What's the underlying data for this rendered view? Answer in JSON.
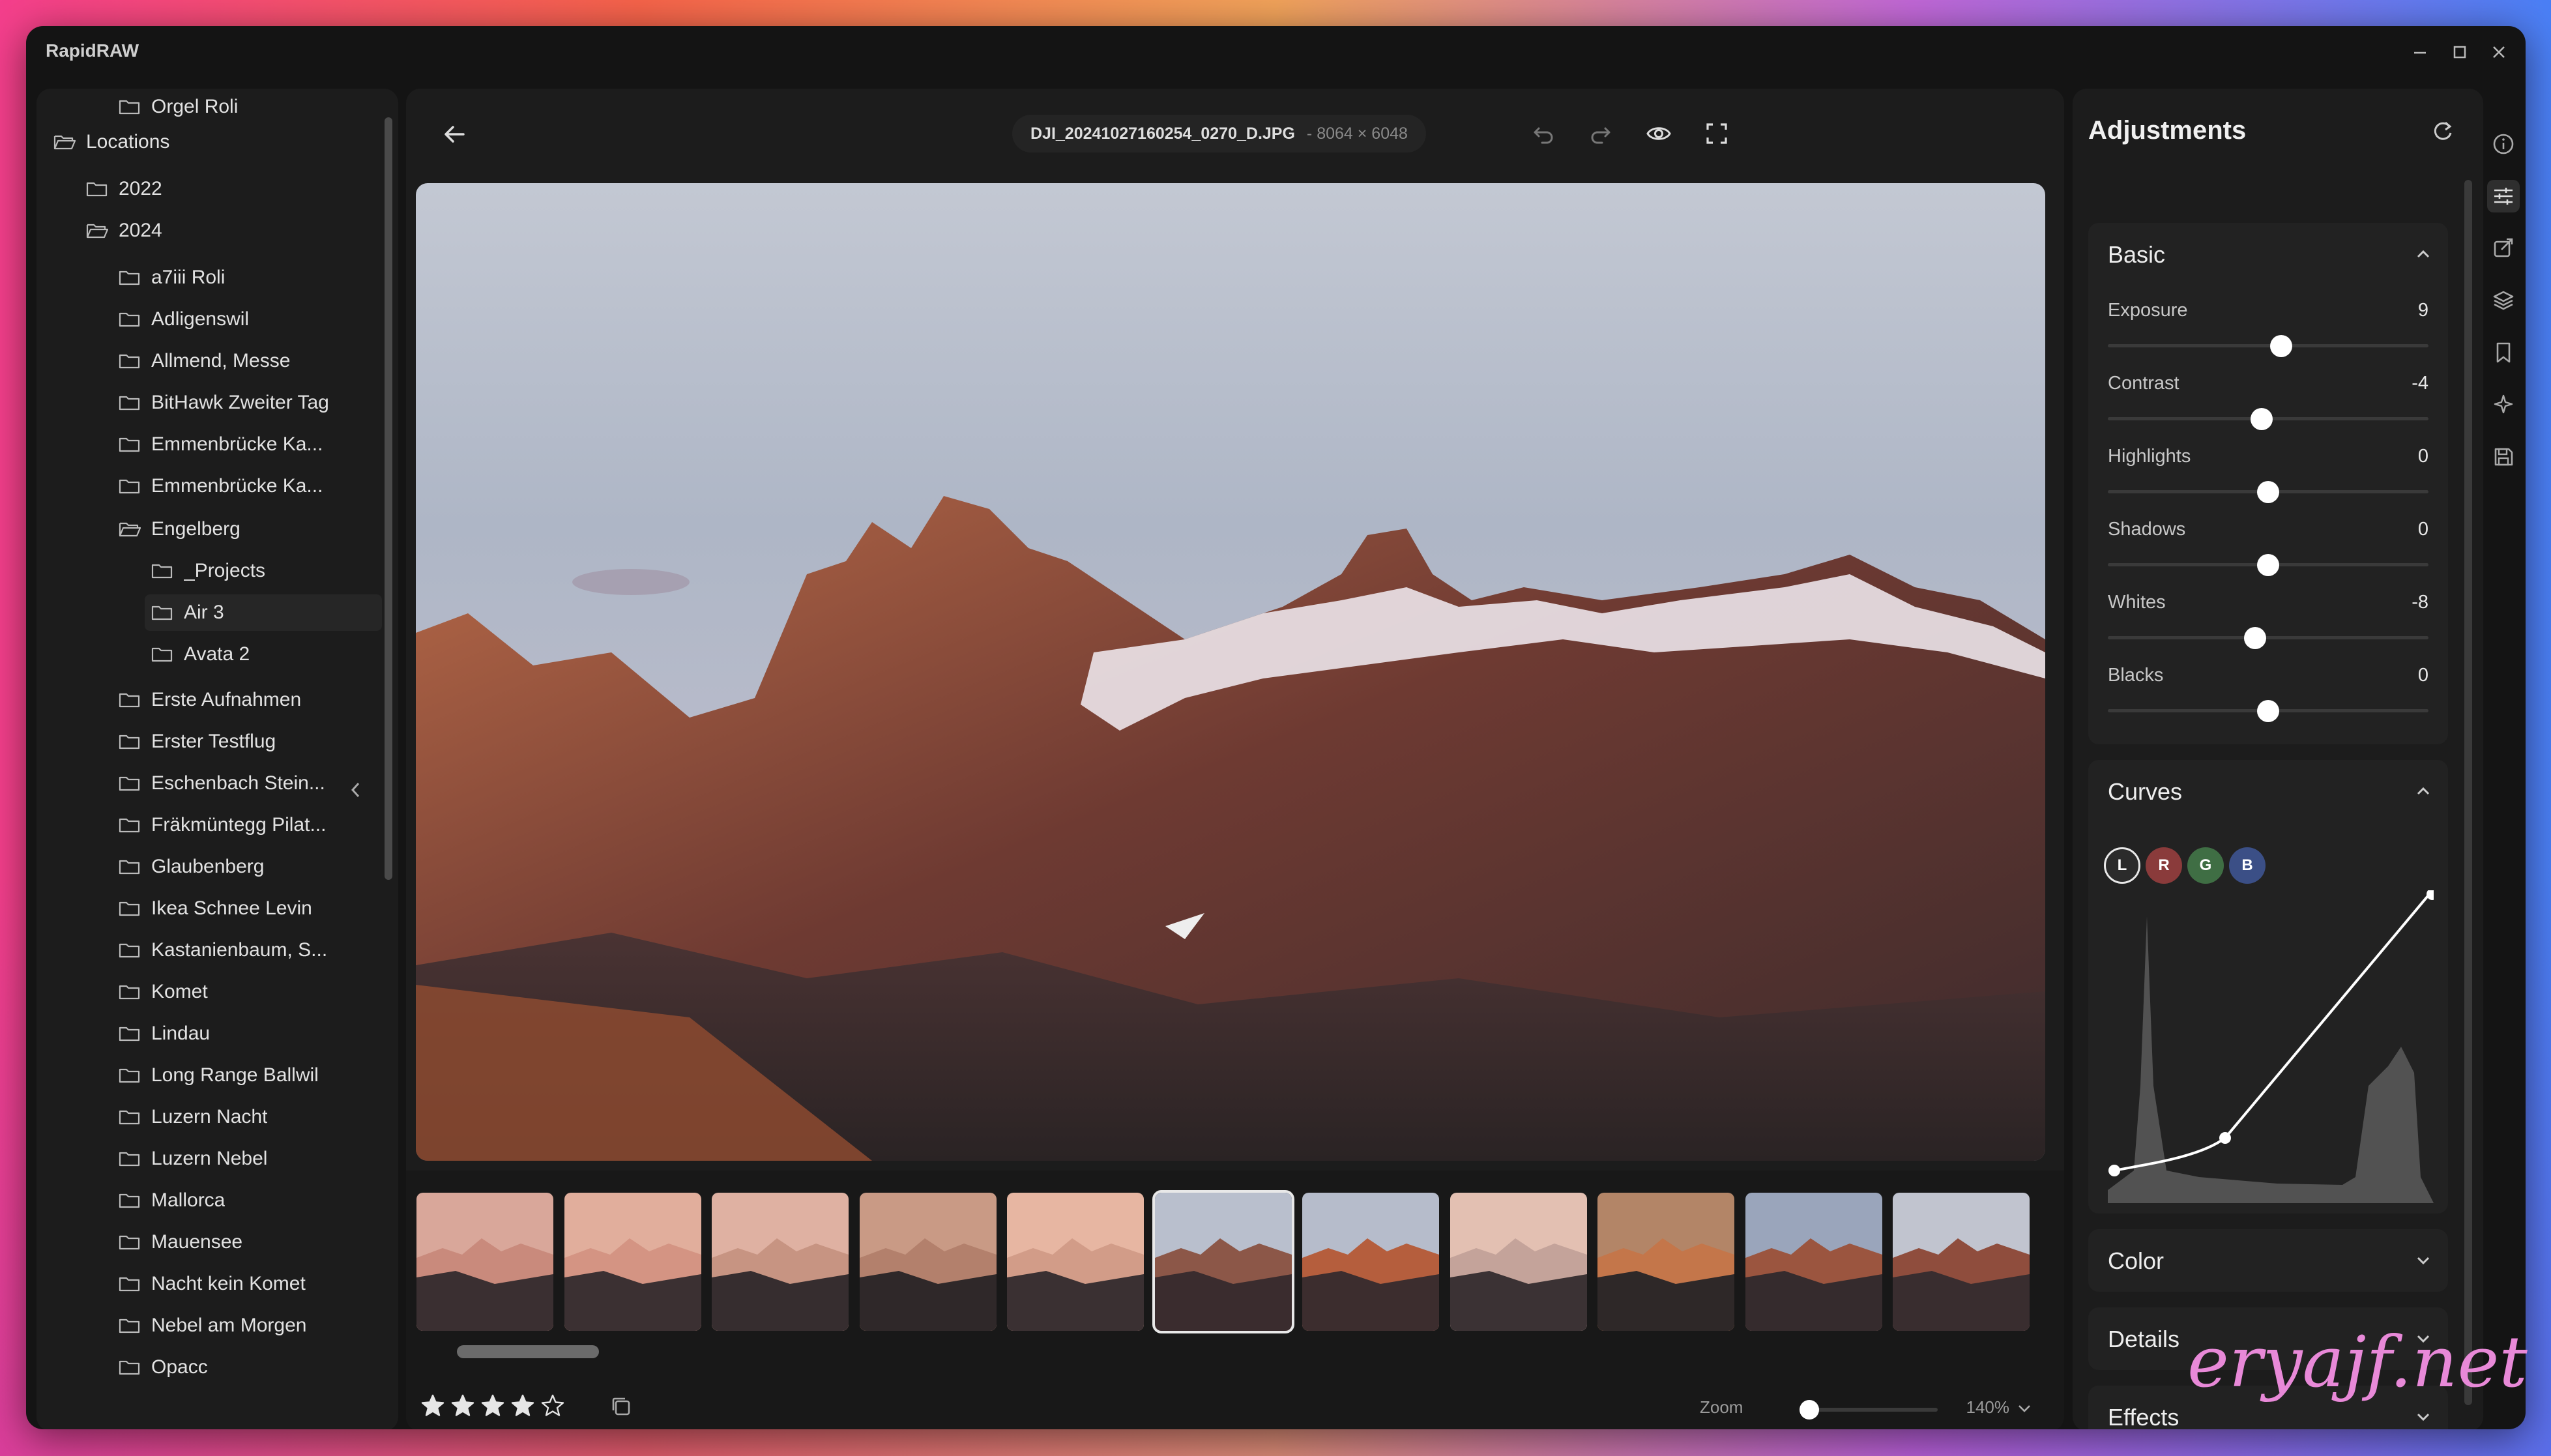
{
  "app": {
    "title": "RapidRAW"
  },
  "window_controls": [
    {
      "name": "minimize-button",
      "icon": "minimize-icon"
    },
    {
      "name": "maximize-button",
      "icon": "maximize-icon"
    },
    {
      "name": "close-button",
      "icon": "close-icon"
    }
  ],
  "sidebar": {
    "root": "Locations",
    "items": [
      {
        "label": "2022",
        "level": 1,
        "open": false
      },
      {
        "label": "2024",
        "level": 1,
        "open": true
      },
      {
        "label": "a7iii Roli",
        "level": 2
      },
      {
        "label": "Adligenswil",
        "level": 2
      },
      {
        "label": "Allmend, Messe",
        "level": 2
      },
      {
        "label": "BitHawk Zweiter Tag",
        "level": 2
      },
      {
        "label": "Emmenbrücke Ka...",
        "level": 2
      },
      {
        "label": "Emmenbrücke Ka...",
        "level": 2
      },
      {
        "label": "Engelberg",
        "level": 2,
        "open": true
      },
      {
        "label": "_Projects",
        "level": 3
      },
      {
        "label": "Air 3",
        "level": 3,
        "selected": true
      },
      {
        "label": "Avata 2",
        "level": 3
      },
      {
        "label": "Erste Aufnahmen",
        "level": 2
      },
      {
        "label": "Erster Testflug",
        "level": 2
      },
      {
        "label": "Eschenbach Stein...",
        "level": 2
      },
      {
        "label": "Fräkmüntegg Pilat...",
        "level": 2
      },
      {
        "label": "Glaubenberg",
        "level": 2
      },
      {
        "label": "Ikea Schnee Levin",
        "level": 2
      },
      {
        "label": "Kastanienbaum, S...",
        "level": 2
      },
      {
        "label": "Komet",
        "level": 2
      },
      {
        "label": "Lindau",
        "level": 2
      },
      {
        "label": "Long Range Ballwil",
        "level": 2
      },
      {
        "label": "Luzern Nacht",
        "level": 2
      },
      {
        "label": "Luzern Nebel",
        "level": 2
      },
      {
        "label": "Mallorca",
        "level": 2
      },
      {
        "label": "Mauensee",
        "level": 2
      },
      {
        "label": "Nacht kein Komet",
        "level": 2
      },
      {
        "label": "Nebel am Morgen",
        "level": 2
      },
      {
        "label": "Opacc",
        "level": 2
      },
      {
        "label": "Orgel Roli",
        "level": 2
      }
    ]
  },
  "viewer": {
    "filename": "DJI_20241027160254_0270_D.JPG",
    "dimensions": "- 8064 × 6048",
    "toolbar_icons": [
      "undo-icon",
      "redo-icon",
      "eye-icon",
      "fullscreen-icon"
    ]
  },
  "filmstrip": {
    "thumbnail_count": 11,
    "active_index": 5,
    "rating": 4,
    "rating_max": 5,
    "zoom_label": "Zoom",
    "zoom_value": "140%",
    "zoom_fraction": 0.05
  },
  "adjustments": {
    "title": "Adjustments",
    "basic": {
      "title": "Basic",
      "sliders": [
        {
          "label": "Exposure",
          "value": "9",
          "fraction": 0.54
        },
        {
          "label": "Contrast",
          "value": "-4",
          "fraction": 0.48
        },
        {
          "label": "Highlights",
          "value": "0",
          "fraction": 0.5
        },
        {
          "label": "Shadows",
          "value": "0",
          "fraction": 0.5
        },
        {
          "label": "Whites",
          "value": "-8",
          "fraction": 0.46
        },
        {
          "label": "Blacks",
          "value": "0",
          "fraction": 0.5
        }
      ]
    },
    "curves": {
      "title": "Curves",
      "channels": [
        {
          "label": "L",
          "color": "#2b2b2b"
        },
        {
          "label": "R",
          "color": "#8a3b3b"
        },
        {
          "label": "G",
          "color": "#3f6e44"
        },
        {
          "label": "B",
          "color": "#3b4f86"
        }
      ]
    },
    "collapsed_sections": [
      "Color",
      "Details",
      "Effects"
    ]
  },
  "right_toolbar_icons": [
    "info-icon",
    "adjustments-icon",
    "crop-icon",
    "layers-icon",
    "bookmark-icon",
    "ai-icon",
    "save-icon"
  ],
  "watermark": "eryajf.net"
}
